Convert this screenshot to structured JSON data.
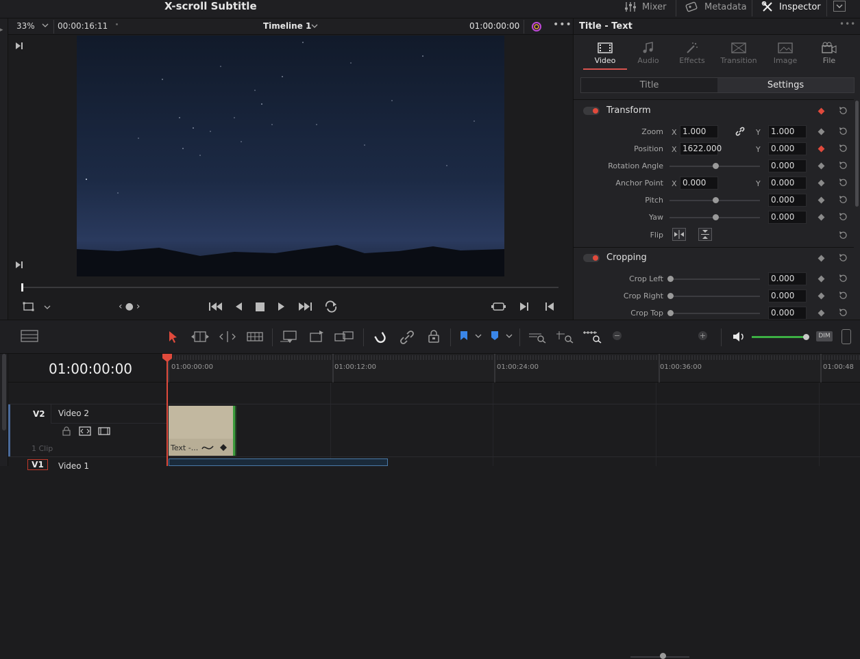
{
  "topbar": {
    "project_title": "X-scroll Subtitle",
    "mixer": "Mixer",
    "metadata": "Metadata",
    "inspector": "Inspector"
  },
  "viewer": {
    "zoom": "33%",
    "duration": "00:00:16:11",
    "timeline_name": "Timeline 1",
    "timecode": "01:00:00:00"
  },
  "inspector": {
    "title": "Title - Text",
    "tabs": [
      "Video",
      "Audio",
      "Effects",
      "Transition",
      "Image",
      "File"
    ],
    "subtabs": [
      "Title",
      "Settings"
    ],
    "transform": {
      "title": "Transform",
      "zoom_label": "Zoom",
      "zoom_x": "1.000",
      "zoom_y": "1.000",
      "position_label": "Position",
      "position_x": "1622.000",
      "position_y": "0.000",
      "rotation_label": "Rotation Angle",
      "rotation": "0.000",
      "anchor_label": "Anchor Point",
      "anchor_x": "0.000",
      "anchor_y": "0.000",
      "pitch_label": "Pitch",
      "pitch": "0.000",
      "yaw_label": "Yaw",
      "yaw": "0.000",
      "flip_label": "Flip",
      "x_axis": "X",
      "y_axis": "Y"
    },
    "cropping": {
      "title": "Cropping",
      "crop_left_label": "Crop Left",
      "crop_left": "0.000",
      "crop_right_label": "Crop Right",
      "crop_right": "0.000",
      "crop_top_label": "Crop Top",
      "crop_top": "0.000"
    }
  },
  "timeline": {
    "timecode": "01:00:00:00",
    "ruler": [
      "01:00:00:00",
      "01:00:12:00",
      "01:00:24:00",
      "01:00:36:00",
      "01:00:48"
    ],
    "tracks": [
      {
        "id": "V2",
        "name": "Video 2",
        "clips": "1 Clip"
      },
      {
        "id": "V1",
        "name": "Video 1"
      }
    ],
    "clip_label": "Text -...",
    "dim": "DIM"
  },
  "colors": {
    "accent_red": "#e04a3c",
    "clip_beige": "#c2b8a0",
    "volume_green": "#3cb043"
  }
}
